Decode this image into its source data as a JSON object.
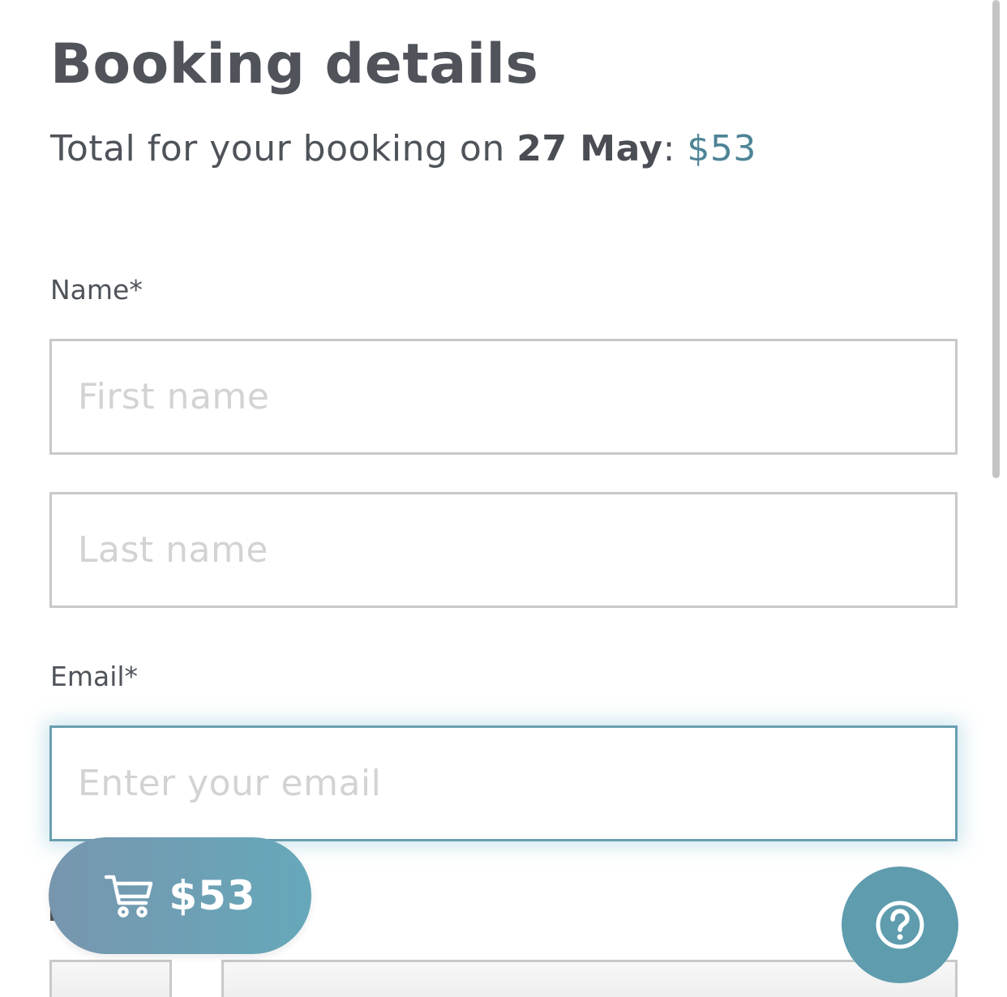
{
  "header": {
    "title": "Booking details",
    "total_prefix": "Total for your booking on ",
    "total_date": "27 May",
    "total_separator": ": ",
    "total_amount": "$53"
  },
  "form": {
    "name_label": "Name*",
    "first_name_placeholder": "First name",
    "last_name_placeholder": "Last name",
    "email_label": "Email*",
    "email_placeholder": "Enter your email"
  },
  "cart": {
    "icon": "cart-icon",
    "amount": "$53"
  },
  "help": {
    "icon": "question-circle-icon"
  },
  "colors": {
    "accent": "#4e8496",
    "help_button": "#5e9cae",
    "cart_gradient_start": "#7796ae",
    "cart_gradient_end": "#66a8ba",
    "focus_border": "#6a9fb1"
  }
}
